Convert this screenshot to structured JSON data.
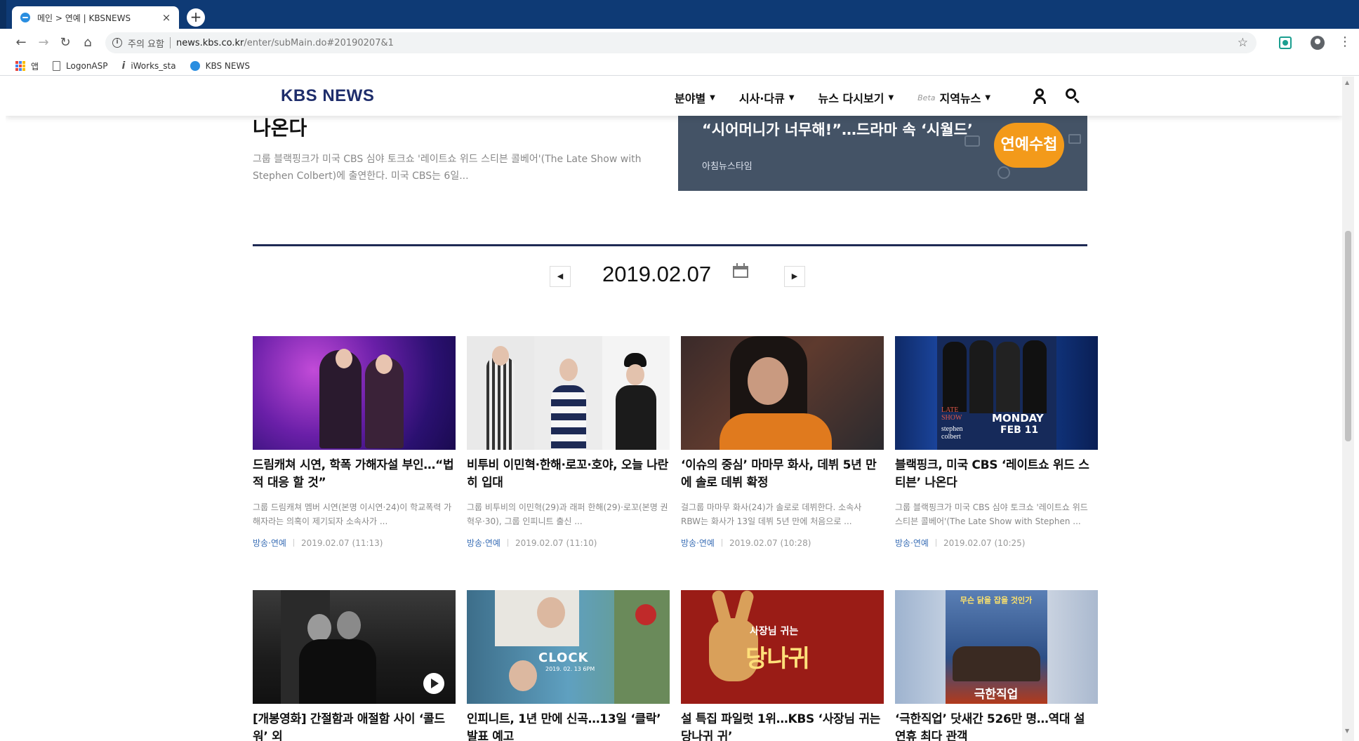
{
  "browser": {
    "tab_title": "메인 > 연예 | KBSNEWS",
    "tab_close": "×",
    "new_tab": "+",
    "security_label": "주의 요함",
    "url_host": "news.kbs.co.kr",
    "url_path": "/enter/subMain.do#20190207&1",
    "bookmarks": [
      {
        "label": "앱",
        "icon": "apps-icon"
      },
      {
        "label": "LogonASP",
        "icon": "page-icon"
      },
      {
        "label": "iWorks_sta",
        "icon": "iworks-icon"
      },
      {
        "label": "KBS NEWS",
        "icon": "kbs-icon"
      }
    ]
  },
  "site": {
    "logo": "KBS NEWS",
    "nav": [
      {
        "label": "분야별"
      },
      {
        "label": "시사·다큐"
      },
      {
        "label": "뉴스 다시보기"
      },
      {
        "label": "지역뉴스",
        "badge": "Beta"
      }
    ]
  },
  "top_article": {
    "title": "나온다",
    "desc": "그룹 블랙핑크가 미국 CBS 심야 토크쇼 '레이트쇼 위드 스티븐 콜베어'(The Late Show with Stephen Colbert)에 출연한다. 미국 CBS는 6일..."
  },
  "banner": {
    "title": "“시어머니가 너무해!”…드라마 속 ‘시월드’",
    "subtitle": "아침뉴스타임",
    "badge": "연예수첩"
  },
  "date_nav": {
    "date": "2019.02.07",
    "prev": "◀",
    "next": "▶"
  },
  "articles": [
    {
      "title": "드림캐쳐 시연, 학폭 가해자설 부인…“법적 대응 할 것”",
      "desc": "그룹 드림캐쳐 멤버 시연(본명 이시연·24)이 학교폭력 가해자라는 의혹이 제기되자 소속사가 ...",
      "category": "방송·연예",
      "time": "2019.02.07 (11:13)"
    },
    {
      "title": "비투비 이민혁·한해·로꼬·호야, 오늘 나란히 입대",
      "desc": "그룹 비투비의 이민혁(29)과 래퍼 한해(29)·로꼬(본명 권혁우·30), 그룹 인피니트 출신 ...",
      "category": "방송·연예",
      "time": "2019.02.07 (11:10)"
    },
    {
      "title": "‘이슈의 중심’ 마마무 화사, 데뷔 5년 만에 솔로 데뷔 확정",
      "desc": "걸그룹 마마무 화사(24)가 솔로로 데뷔한다. 소속사 RBW는 화사가 13일 데뷔 5년 만에 처음으로 ...",
      "category": "방송·연예",
      "time": "2019.02.07 (10:28)"
    },
    {
      "title": "블랙핑크, 미국 CBS ‘레이트쇼 위드 스티븐’ 나온다",
      "desc": "그룹 블랙핑크가 미국 CBS 심야 토크쇼 '레이트쇼 위드 스티븐 콜베어'(The Late Show with Stephen ...",
      "category": "방송·연예",
      "time": "2019.02.07 (10:25)"
    },
    {
      "title": "[개봉영화] 간절함과 애절함 사이 ‘콜드 워’ 외"
    },
    {
      "title": "인피니트, 1년 만에 신곡…13일 ‘클락’ 발표 예고"
    },
    {
      "title": "설 특집 파일럿 1위…KBS ‘사장님 귀는 당나귀 귀’"
    },
    {
      "title": "‘극한직업’ 닷새간 526만 명…역대 설 연휴 최다 관객"
    }
  ],
  "thumb_text": {
    "late_show": "LATE SHOW",
    "stephen": "stephen colbert",
    "monday": "MONDAY",
    "feb": "FEB 11",
    "clock": "CLOCK",
    "clock_date": "2019. 02. 13 6PM",
    "donkey_top": "사장님 귀는",
    "donkey_main": "당나귀",
    "movie_title": "극한직업",
    "movie_tag": "무슨 닭을 잡을 것인가"
  },
  "colors": {
    "chrome_bar": "#0e3a75",
    "logo": "#1e2d6b",
    "divider": "#1e2a54",
    "category": "#3b6fb6",
    "banner_bg": "#445366",
    "badge": "#f39a1a"
  }
}
